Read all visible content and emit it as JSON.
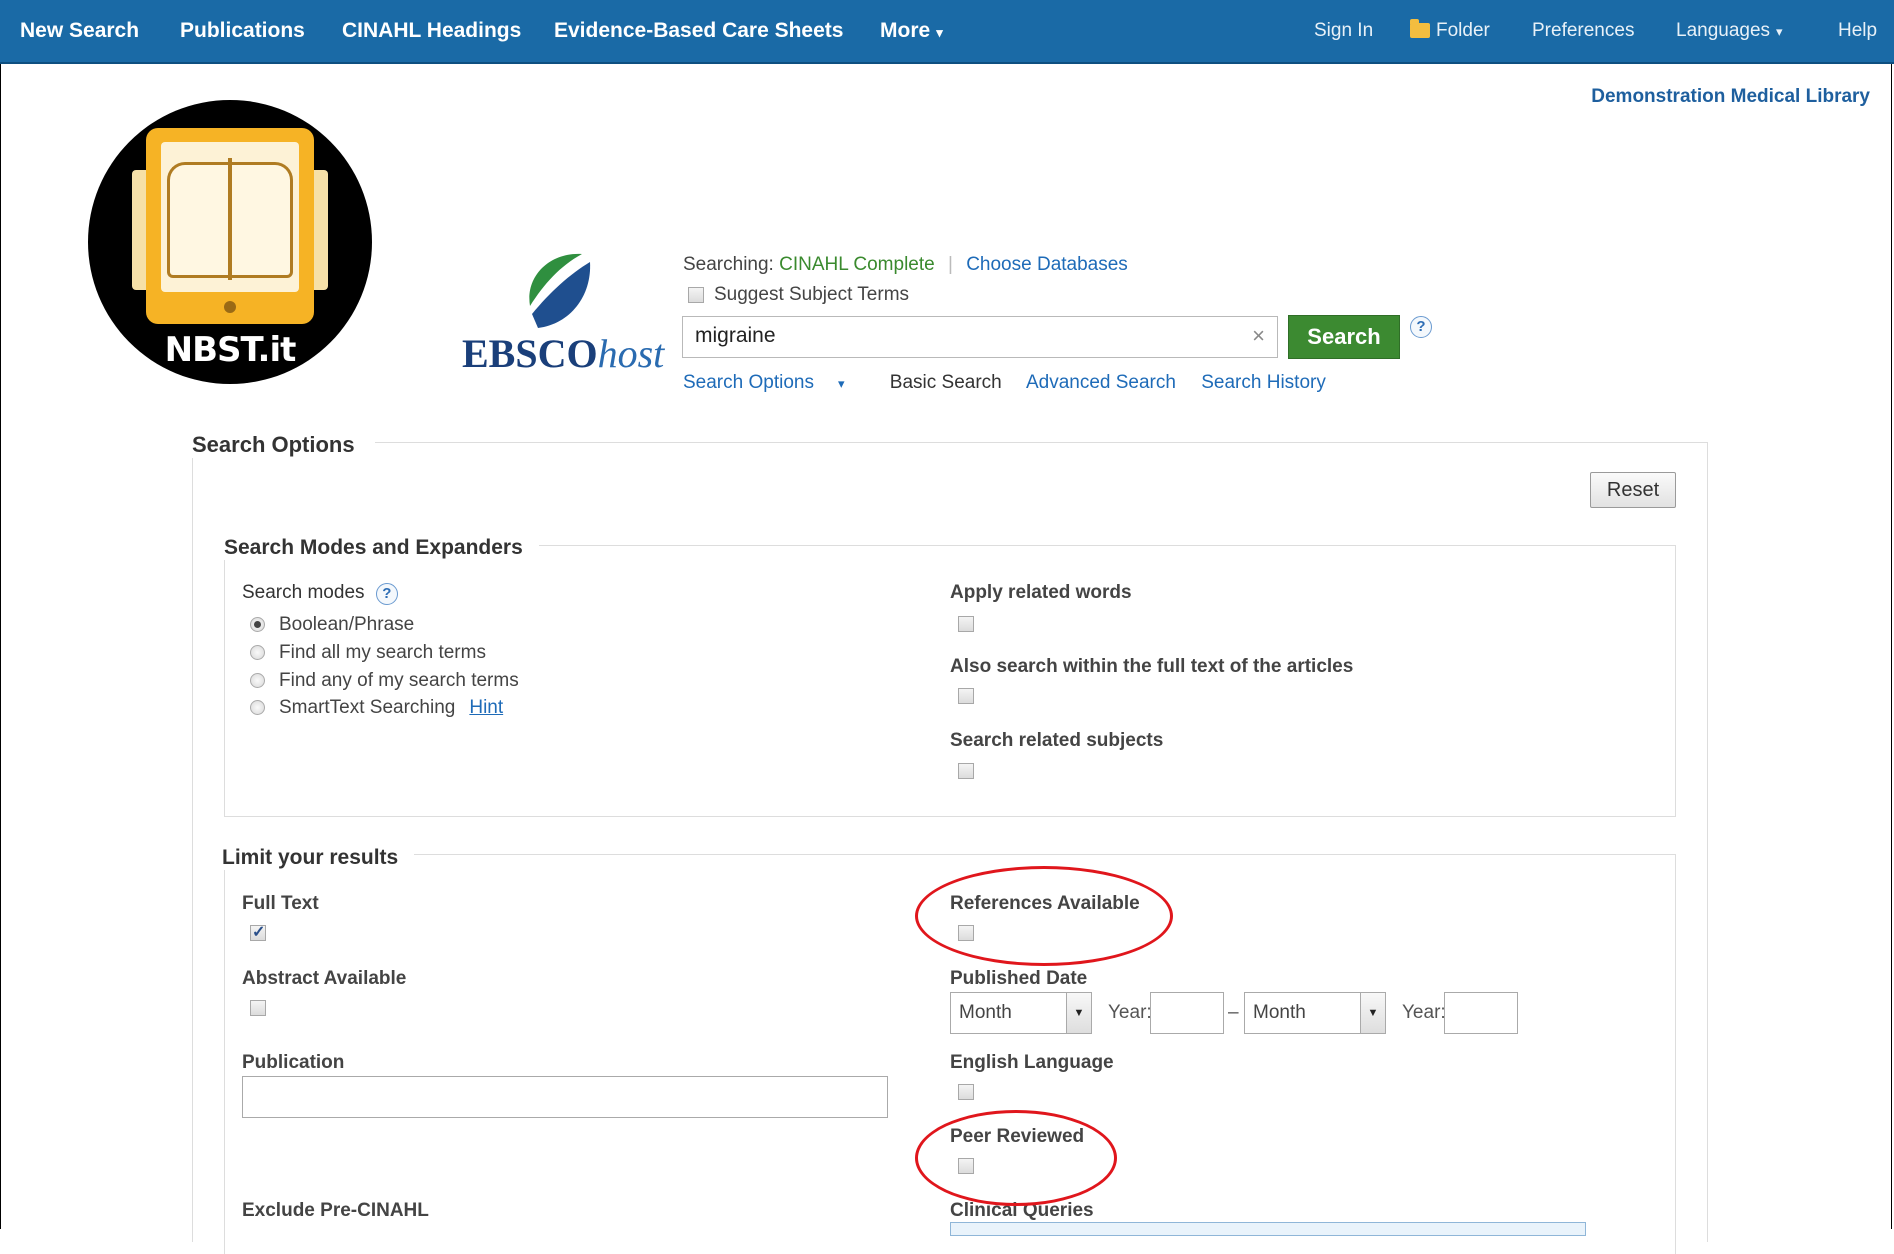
{
  "topnav": {
    "new_search": "New Search",
    "publications": "Publications",
    "cinahl_headings": "CINAHL Headings",
    "care_sheets": "Evidence-Based Care Sheets",
    "more": "More",
    "sign_in": "Sign In",
    "folder": "Folder",
    "preferences": "Preferences",
    "languages": "Languages",
    "help": "Help"
  },
  "library_name": "Demonstration Medical Library",
  "badge": {
    "label": "NBST.it"
  },
  "logo": {
    "brand": "EBSCO",
    "suffix": "host"
  },
  "search": {
    "searching_label": "Searching:",
    "database": "CINAHL Complete",
    "choose_databases": "Choose Databases",
    "suggest_subject_terms": "Suggest Subject Terms",
    "query": "migraine",
    "clear": "×",
    "button": "Search",
    "help": "?",
    "links": {
      "search_options": "Search Options",
      "basic_search": "Basic Search",
      "advanced_search": "Advanced Search",
      "search_history": "Search History"
    }
  },
  "search_options": {
    "title": "Search Options",
    "reset": "Reset",
    "modes_section": {
      "title": "Search Modes and Expanders",
      "modes_label": "Search modes",
      "help": "?",
      "modes": [
        "Boolean/Phrase",
        "Find all my search terms",
        "Find any of my search terms",
        "SmartText Searching"
      ],
      "selected_mode": "Boolean/Phrase",
      "hint": "Hint",
      "expanders": [
        "Apply related words",
        "Also search within the full text of the articles",
        "Search related subjects"
      ]
    },
    "limits_section": {
      "title": "Limit your results",
      "full_text": "Full Text",
      "full_text_checked": true,
      "abstract_available": "Abstract Available",
      "publication": "Publication",
      "exclude_pre_cinahl": "Exclude Pre-CINAHL",
      "references_available": "References Available",
      "published_date": "Published Date",
      "month": "Month",
      "year": "Year:",
      "dash": "–",
      "english_language": "English Language",
      "peer_reviewed": "Peer Reviewed",
      "clinical_queries": "Clinical Queries"
    }
  },
  "colors": {
    "nav_bg": "#1a6aa6",
    "search_button": "#3c8a31",
    "database_text": "#3a8a2e",
    "link": "#1e6bb8",
    "highlight_circle": "#e0161c"
  },
  "icons": [
    "folder-icon",
    "caret-down-icon",
    "clear-icon",
    "help-icon"
  ]
}
